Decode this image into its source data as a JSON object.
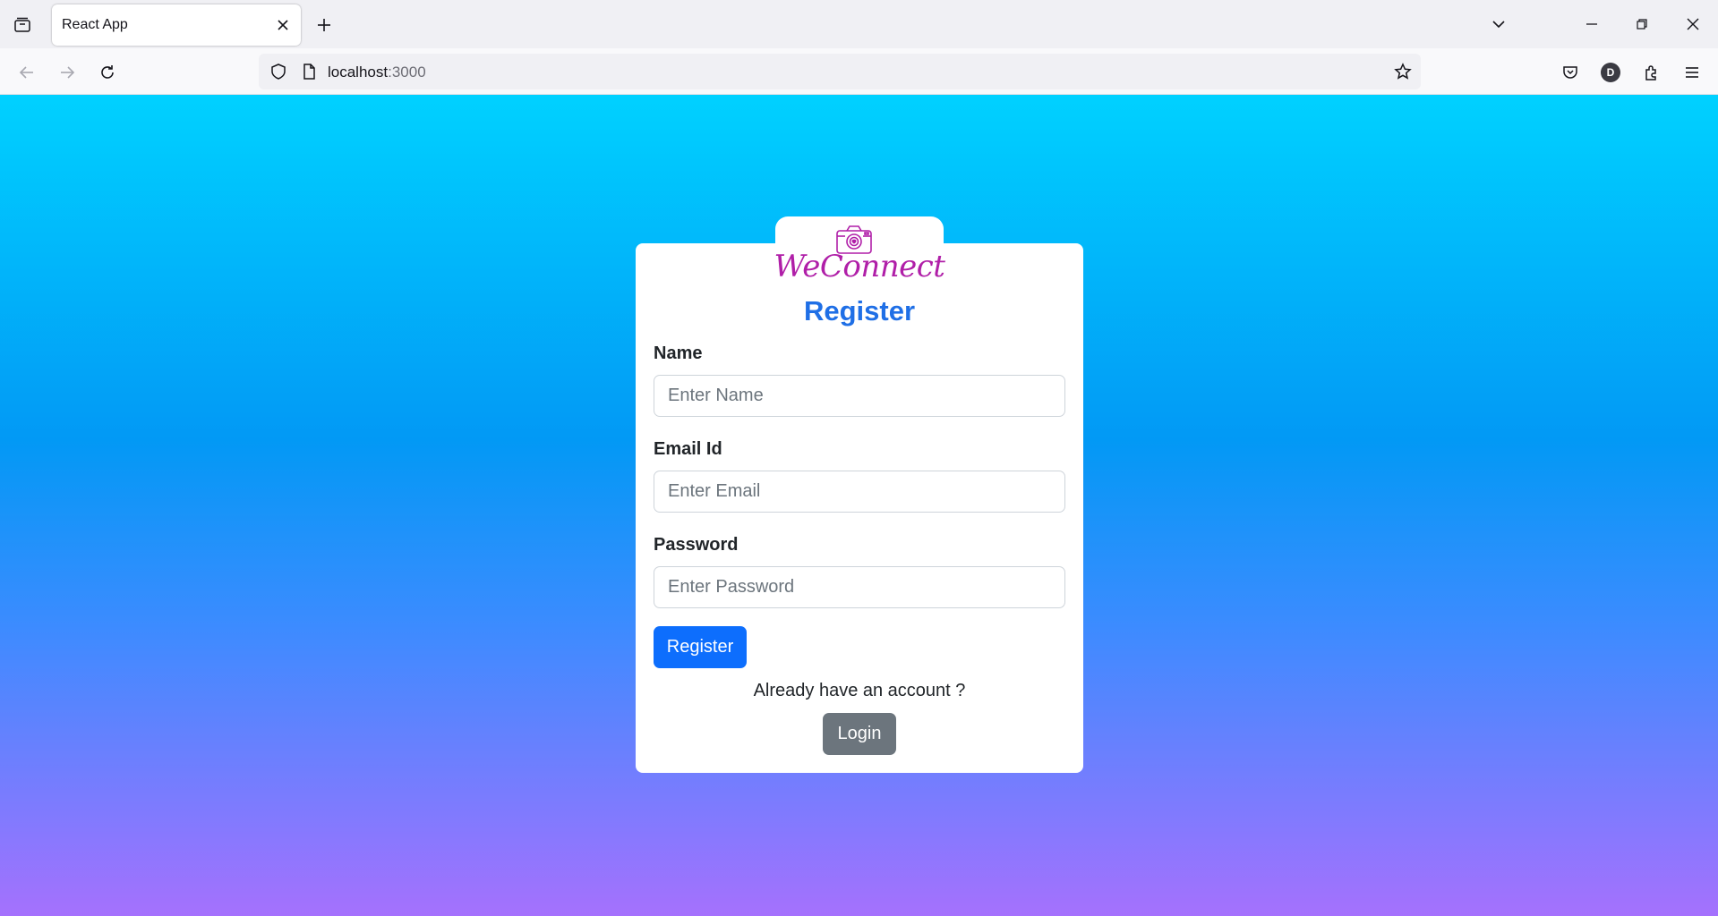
{
  "browser": {
    "tab_title": "React App",
    "url_host": "localhost",
    "url_port": ":3000",
    "account_initial": "D"
  },
  "page": {
    "brand": "WeConnect",
    "heading": "Register",
    "name_label": "Name",
    "name_placeholder": "Enter Name",
    "email_label": "Email Id",
    "email_placeholder": "Enter Email",
    "password_label": "Password",
    "password_placeholder": "Enter Password",
    "register_button": "Register",
    "already_text": "Already have an account ?",
    "login_button": "Login"
  },
  "colors": {
    "gradient_top": "#00d1ff",
    "gradient_bottom": "#a571fd",
    "brand": "#b01fa8",
    "heading": "#1f6fe6",
    "primary_button": "#0d6efd",
    "secondary_button": "#6c757d"
  },
  "icons": [
    "tab-list-icon",
    "close-icon",
    "plus-icon",
    "chevron-down-icon",
    "minimize-icon",
    "restore-icon",
    "back-arrow-icon",
    "forward-arrow-icon",
    "reload-icon",
    "shield-icon",
    "page-icon",
    "star-icon",
    "pocket-icon",
    "extensions-icon",
    "menu-icon",
    "camera-icon"
  ]
}
